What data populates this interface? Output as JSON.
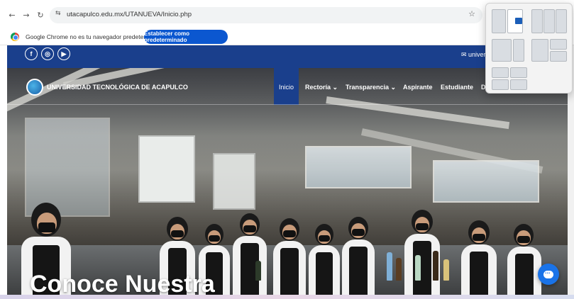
{
  "browser": {
    "nav": {
      "back": "←",
      "forward": "→",
      "reload": "↻"
    },
    "site_info_icon": "⇆",
    "url": "utacapulco.edu.mx/UTANUEVA/Inicio.php",
    "star_icon": "☆"
  },
  "infobar": {
    "message": "Google Chrome no es tu navegador predeterminado",
    "button": "Establecer como predeterminado"
  },
  "site": {
    "socials": [
      "f",
      "◎",
      "▶"
    ],
    "mail": "✉ universi",
    "logo_text": "UNIVERSIDAD TECNOLÓGICA DE ACAPULCO",
    "nav": [
      {
        "label": "Inicio",
        "active": true
      },
      {
        "label": "Rectoría ⌄"
      },
      {
        "label": "Transparencia ⌄"
      },
      {
        "label": "Aspirante"
      },
      {
        "label": "Estudiante"
      },
      {
        "label": "D"
      }
    ],
    "hero_title": "Conoce Nuestra",
    "colors": {
      "brand_blue": "#1a3f8c",
      "chat_blue": "#1a73e8"
    }
  },
  "icons": {
    "chat": "chat-icon",
    "word": "word-icon"
  }
}
